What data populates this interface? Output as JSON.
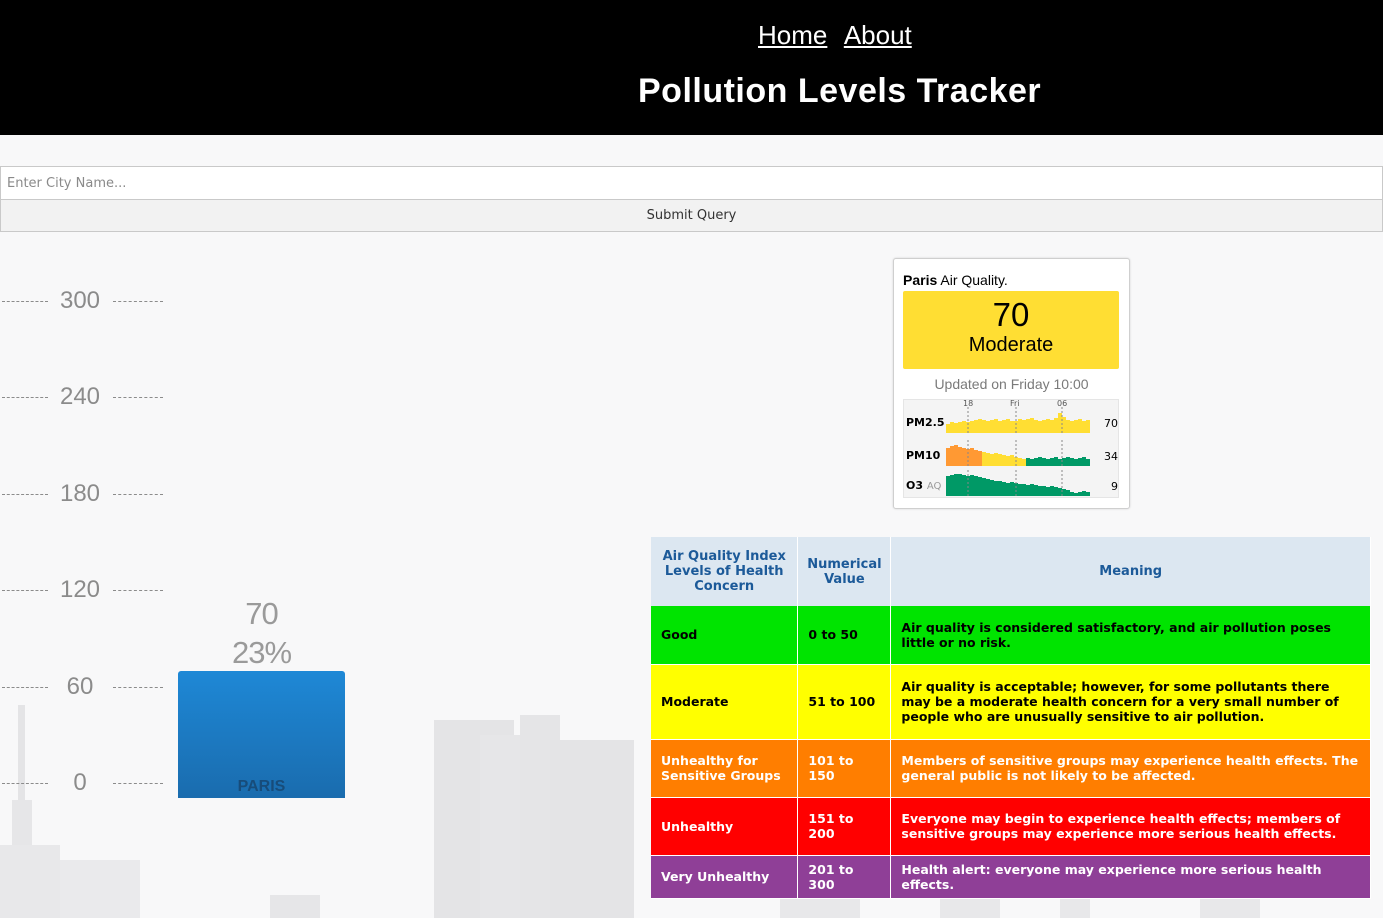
{
  "nav": {
    "home": "Home",
    "about": "About"
  },
  "title": "Pollution Levels Tracker",
  "search": {
    "placeholder": "Enter City Name...",
    "submit": "Submit Query"
  },
  "chart_data": {
    "type": "bar",
    "categories": [
      "PARIS"
    ],
    "values": [
      70
    ],
    "data_labels": [
      "70",
      "23%"
    ],
    "yticks": [
      0,
      60,
      120,
      180,
      240,
      300
    ],
    "ylim": [
      0,
      300
    ],
    "series_color": "#1e88d6"
  },
  "widget": {
    "city": "Paris",
    "title_suffix": "Air Quality.",
    "aqi": "70",
    "level": "Moderate",
    "level_color": "#ffde33",
    "updated": "Updated on Friday 10:00",
    "dates": [
      "18",
      "Fri",
      "06"
    ],
    "pollutants": [
      {
        "name": "PM2.5",
        "suffix": "",
        "value": "70",
        "colors": [
          "#ffde33"
        ]
      },
      {
        "name": "PM10",
        "suffix": "",
        "value": "34",
        "colors": [
          "#ff9933",
          "#ffde33",
          "#009966"
        ]
      },
      {
        "name": "O3",
        "suffix": "AQ",
        "value": "9",
        "colors": [
          "#009966"
        ]
      }
    ]
  },
  "table": {
    "headers": [
      "Air Quality Index Levels of Health Concern",
      "Numerical Value",
      "Meaning"
    ],
    "header_color": "#1c5a99",
    "rows": [
      {
        "level": "Good",
        "range": "0 to 50",
        "meaning": "Air quality is considered satisfactory, and air pollution poses little or no risk.",
        "color": "#00e400",
        "text": "#000000"
      },
      {
        "level": "Moderate",
        "range": "51 to 100",
        "meaning": "Air quality is acceptable; however, for some pollutants there may be a moderate health concern for a very small number of people who are unusually sensitive to air pollution.",
        "color": "#ffff00",
        "text": "#000000"
      },
      {
        "level": "Unhealthy for Sensitive Groups",
        "range": "101 to 150",
        "meaning": "Members of sensitive groups may experience health effects. The general public is not likely to be affected.",
        "color": "#ff7e00",
        "text": "#ffffff"
      },
      {
        "level": "Unhealthy",
        "range": "151 to 200",
        "meaning": "Everyone may begin to experience health effects; members of sensitive groups may experience more serious health effects.",
        "color": "#ff0000",
        "text": "#ffffff"
      },
      {
        "level": "Very Unhealthy",
        "range": "201 to 300",
        "meaning": "Health alert: everyone may experience more serious health effects.",
        "color": "#8f3f97",
        "text": "#ffffff"
      }
    ]
  }
}
